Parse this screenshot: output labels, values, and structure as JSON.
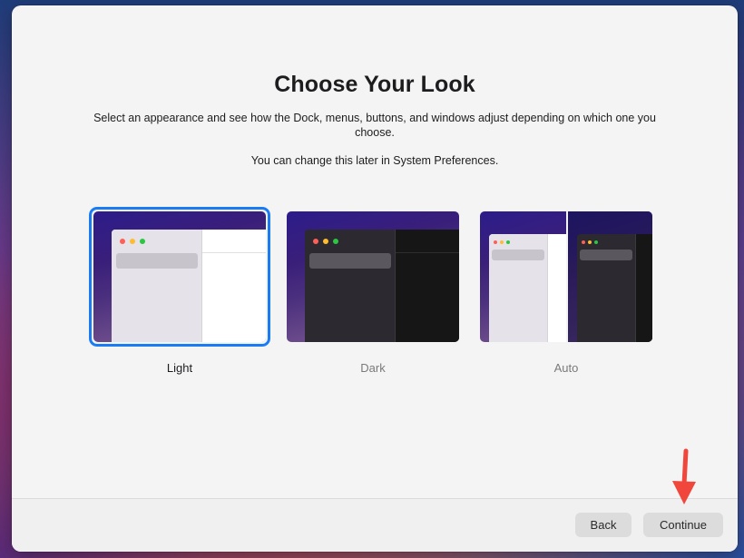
{
  "window": {
    "title": "Choose Your Look",
    "description": "Select an appearance and see how the Dock, menus, buttons, and windows adjust depending on which one you choose.",
    "note": "You can change this later in System Preferences."
  },
  "appearance_options": [
    {
      "label": "Light",
      "selected": true
    },
    {
      "label": "Dark",
      "selected": false
    },
    {
      "label": "Auto",
      "selected": false
    }
  ],
  "footer": {
    "back_label": "Back",
    "continue_label": "Continue"
  },
  "colors": {
    "selection_accent": "#1a7cf5",
    "annotation_arrow": "#f0463c"
  }
}
